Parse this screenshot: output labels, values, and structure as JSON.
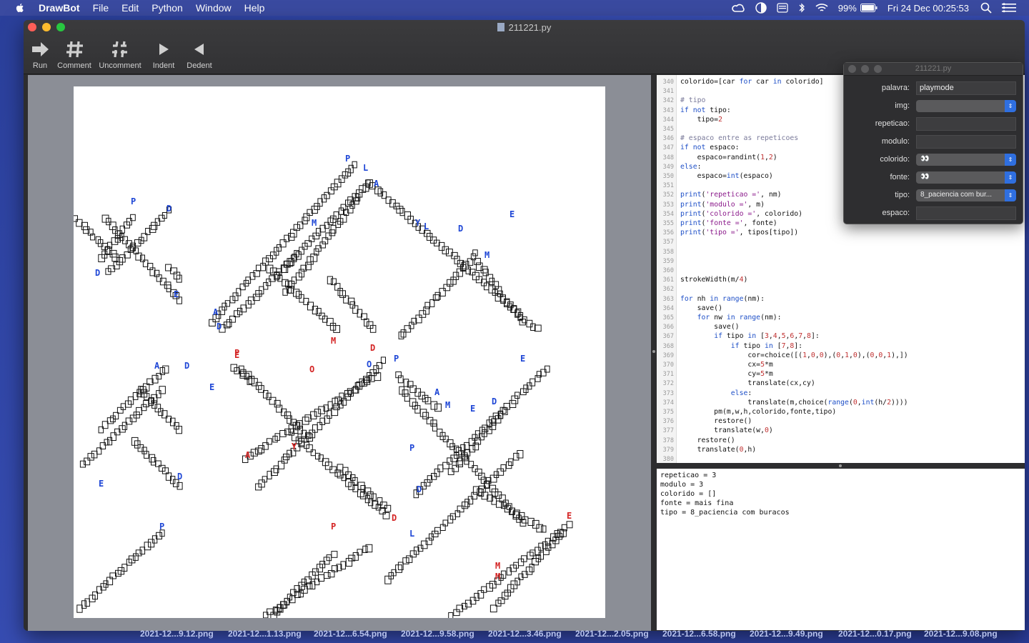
{
  "menubar": {
    "app": "DrawBot",
    "items": [
      "File",
      "Edit",
      "Python",
      "Window",
      "Help"
    ],
    "battery": "99%",
    "datetime": "Fri 24 Dec  00:25:53"
  },
  "window": {
    "title": "211221.py",
    "toolbar": {
      "run": "Run",
      "comment": "Comment",
      "uncomment": "Uncomment",
      "indent": "Indent",
      "dedent": "Dedent"
    }
  },
  "editor": {
    "lines": [
      {
        "n": "340",
        "html": "colorido=[car <span class='kw'>for</span> car <span class='kw'>in</span> colorido]"
      },
      {
        "n": "341",
        "html": ""
      },
      {
        "n": "342",
        "html": "<span class='cm'># tipo</span>"
      },
      {
        "n": "343",
        "html": "<span class='kw'>if not</span> tipo:"
      },
      {
        "n": "344",
        "html": "    tipo=<span class='num'>2</span>"
      },
      {
        "n": "345",
        "html": ""
      },
      {
        "n": "346",
        "html": "<span class='cm'># espaco entre as repeticoes</span>"
      },
      {
        "n": "347",
        "html": "<span class='kw'>if not</span> espaco:"
      },
      {
        "n": "348",
        "html": "    espaco=randint(<span class='num'>1</span>,<span class='num'>2</span>)"
      },
      {
        "n": "349",
        "html": "<span class='kw'>else</span>:"
      },
      {
        "n": "350",
        "html": "    espaco=<span class='kw'>int</span>(espaco)"
      },
      {
        "n": "351",
        "html": ""
      },
      {
        "n": "352",
        "html": "<span class='kw'>print</span>(<span class='str'>'repeticao ='</span>, nm)"
      },
      {
        "n": "353",
        "html": "<span class='kw'>print</span>(<span class='str'>'modulo ='</span>, m)"
      },
      {
        "n": "354",
        "html": "<span class='kw'>print</span>(<span class='str'>'colorido ='</span>, colorido)"
      },
      {
        "n": "355",
        "html": "<span class='kw'>print</span>(<span class='str'>'fonte ='</span>, fonte)"
      },
      {
        "n": "356",
        "html": "<span class='kw'>print</span>(<span class='str'>'tipo ='</span>, tipos[tipo])"
      },
      {
        "n": "357",
        "html": ""
      },
      {
        "n": "358",
        "html": ""
      },
      {
        "n": "359",
        "html": ""
      },
      {
        "n": "360",
        "html": ""
      },
      {
        "n": "361",
        "html": "strokeWidth(m/<span class='num'>4</span>)"
      },
      {
        "n": "362",
        "html": ""
      },
      {
        "n": "363",
        "html": "<span class='kw'>for</span> nh <span class='kw'>in range</span>(nm):"
      },
      {
        "n": "364",
        "html": "    save()"
      },
      {
        "n": "365",
        "html": "    <span class='kw'>for</span> nw <span class='kw'>in range</span>(nm):"
      },
      {
        "n": "366",
        "html": "        save()"
      },
      {
        "n": "367",
        "html": "        <span class='kw'>if</span> tipo <span class='kw'>in</span> [<span class='num'>3</span>,<span class='num'>4</span>,<span class='num'>5</span>,<span class='num'>6</span>,<span class='num'>7</span>,<span class='num'>8</span>]:"
      },
      {
        "n": "368",
        "html": "            <span class='kw'>if</span> tipo <span class='kw'>in</span> [<span class='num'>7</span>,<span class='num'>8</span>]:"
      },
      {
        "n": "369",
        "html": "                cor=choice([(<span class='num'>1</span>,<span class='num'>0</span>,<span class='num'>0</span>),(<span class='num'>0</span>,<span class='num'>1</span>,<span class='num'>0</span>),(<span class='num'>0</span>,<span class='num'>0</span>,<span class='num'>1</span>),])"
      },
      {
        "n": "370",
        "html": "                cx=<span class='num'>5</span>*m"
      },
      {
        "n": "371",
        "html": "                cy=<span class='num'>5</span>*m"
      },
      {
        "n": "372",
        "html": "                translate(cx,cy)"
      },
      {
        "n": "373",
        "html": "            <span class='kw'>else</span>:"
      },
      {
        "n": "374",
        "html": "                translate(m,choice(<span class='kw'>range</span>(<span class='num'>0</span>,<span class='kw'>int</span>(h/<span class='num'>2</span>))))"
      },
      {
        "n": "375",
        "html": "        pm(m,w,h,colorido,fonte,tipo)"
      },
      {
        "n": "376",
        "html": "        restore()"
      },
      {
        "n": "377",
        "html": "        translate(w,<span class='num'>0</span>)"
      },
      {
        "n": "378",
        "html": "    restore()"
      },
      {
        "n": "379",
        "html": "    translate(<span class='num'>0</span>,h)"
      },
      {
        "n": "380",
        "html": ""
      }
    ]
  },
  "output": {
    "lines": [
      "repeticao = 3",
      "modulo = 3",
      "colorido = []",
      "fonte = mais fina",
      "tipo = 8_paciencia com buracos"
    ]
  },
  "panel": {
    "title": "211221.py",
    "rows": [
      {
        "label": "palavra:",
        "kind": "field",
        "value": "playmode"
      },
      {
        "label": "img:",
        "kind": "select",
        "value": ""
      },
      {
        "label": "repeticao:",
        "kind": "field",
        "value": ""
      },
      {
        "label": "modulo:",
        "kind": "field",
        "value": ""
      },
      {
        "label": "colorido:",
        "kind": "select",
        "value": "👀"
      },
      {
        "label": "fonte:",
        "kind": "select",
        "value": "👀"
      },
      {
        "label": "tipo:",
        "kind": "select",
        "value": "8_paciencia com bur..."
      },
      {
        "label": "espaco:",
        "kind": "field",
        "value": ""
      }
    ]
  },
  "desktop_files": [
    "2021-12...9.12.png",
    "2021-12...1.13.png",
    "2021-12...6.54.png",
    "2021-12...9.58.png",
    "2021-12...3.46.png",
    "2021-12...2.05.png",
    "2021-12...6.58.png",
    "2021-12...9.49.png",
    "2021-12...0.17.png",
    "2021-12...9.08.png"
  ],
  "artwork": {
    "colors": {
      "black": "#111111",
      "blue": "#1f47d6",
      "red": "#d42424"
    },
    "letters": [
      {
        "ch": "P",
        "c": "blue"
      },
      {
        "ch": "L",
        "c": "blue"
      },
      {
        "ch": "A",
        "c": "blue"
      },
      {
        "ch": "Y",
        "c": "blue"
      },
      {
        "ch": "M",
        "c": "blue"
      },
      {
        "ch": "O",
        "c": "blue"
      },
      {
        "ch": "D",
        "c": "blue"
      },
      {
        "ch": "E",
        "c": "blue"
      },
      {
        "ch": "P",
        "c": "red"
      },
      {
        "ch": "L",
        "c": "red"
      },
      {
        "ch": "A",
        "c": "red"
      },
      {
        "ch": "Y",
        "c": "red"
      },
      {
        "ch": "M",
        "c": "red"
      },
      {
        "ch": "O",
        "c": "red"
      },
      {
        "ch": "D",
        "c": "red"
      },
      {
        "ch": "E",
        "c": "red"
      }
    ]
  }
}
